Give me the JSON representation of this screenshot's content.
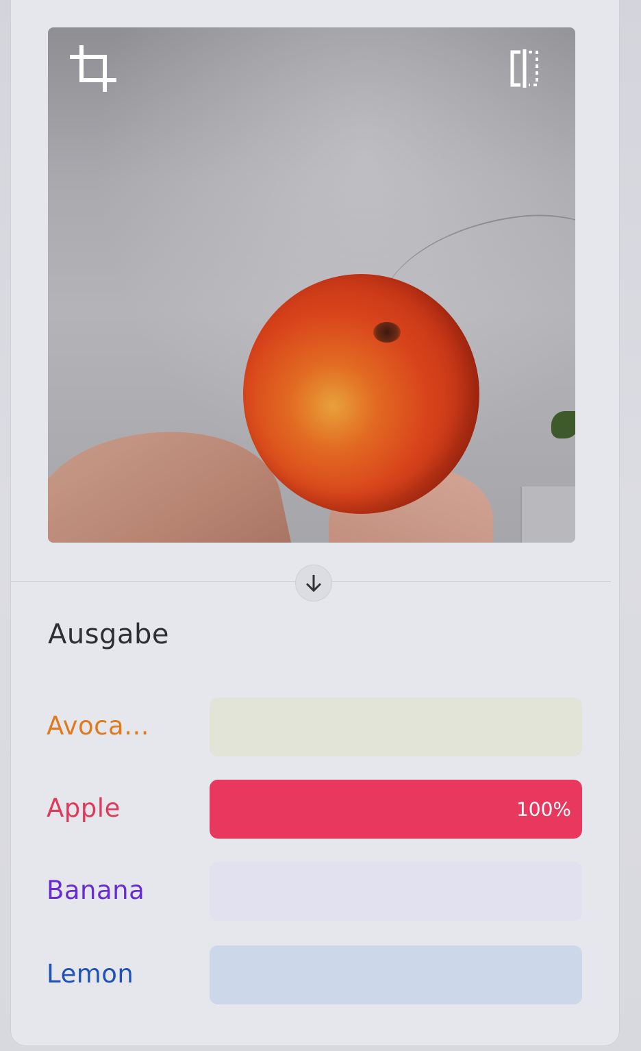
{
  "toolbar": {
    "crop_icon": "crop-icon",
    "flip_icon": "flip-horizontal-icon"
  },
  "preview": {
    "subject": "apple held in hand",
    "arrow_icon": "arrow-down-icon"
  },
  "output": {
    "title": "Ausgabe",
    "classes": [
      {
        "label": "Avoca...",
        "value": 0,
        "text": "",
        "color": "#e07a1c",
        "track": "#dfe3d3",
        "fill": "#e07a1c"
      },
      {
        "label": "Apple",
        "value": 1.0,
        "text": "100%",
        "color": "#e03a5a",
        "track": "#f7d2da",
        "fill": "#e8385e"
      },
      {
        "label": "Banana",
        "value": 0,
        "text": "",
        "color": "#6a2bd6",
        "track": "#e1dff0",
        "fill": "#6a2bd6"
      },
      {
        "label": "Lemon",
        "value": 0,
        "text": "",
        "color": "#1f52b8",
        "track": "#c7d3ea",
        "fill": "#1f52b8"
      }
    ]
  }
}
